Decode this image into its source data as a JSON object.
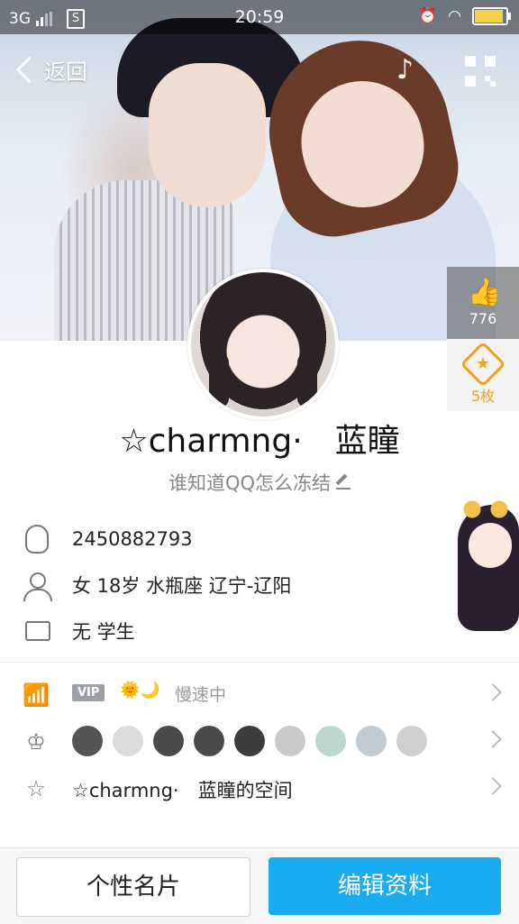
{
  "status_bar": {
    "network": "3G",
    "time": "20:59",
    "battery_level": 0.85
  },
  "nav": {
    "back_label": "返回"
  },
  "profile": {
    "like_count": "776",
    "medal_count": "5枚",
    "name": "☆charmng·　蓝瞳",
    "signature": "谁知道QQ怎么冻结"
  },
  "info": {
    "qq_number": "2450882793",
    "basic": "女  18岁  水瓶座  辽宁-辽阳",
    "occupation": "无 学生"
  },
  "vip": {
    "badge": "VIP",
    "status": "慢速中"
  },
  "zone": {
    "label": "☆charmng·　蓝瞳的空间"
  },
  "buttons": {
    "card": "个性名片",
    "edit": "编辑资料"
  },
  "colors": {
    "accent": "#19acf0",
    "medal": "#f4a11a"
  }
}
